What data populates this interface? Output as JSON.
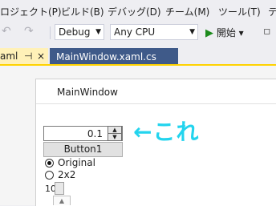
{
  "menubar": {
    "items": [
      "ロジェクト(P)",
      "ビルド(B)",
      "デバッグ(D)",
      "チーム(M)",
      "ツール(T)",
      "テ"
    ]
  },
  "toolbar": {
    "undo_glyph": "↶",
    "redo_glyph": "↷",
    "config": "Debug",
    "platform": "Any CPU",
    "start_label": "開始",
    "play_glyph": "▶",
    "dropdown_glyph": "▾"
  },
  "tabs": {
    "active": "aml",
    "pin_glyph": "⊣",
    "close_glyph": "×",
    "inactive": "MainWindow.xaml.cs"
  },
  "window": {
    "title": "MainWindow",
    "numeric_value": "0.1",
    "button_label": "Button1",
    "radio_options": [
      {
        "label": "Original",
        "checked": true
      },
      {
        "label": "2x2",
        "checked": false
      }
    ],
    "slider_value": "10"
  },
  "annotation": "←これ",
  "colors": {
    "tab_active": "#fff1b8",
    "tab_inactive": "#3f5a89",
    "annotation": "#23d4ee"
  }
}
